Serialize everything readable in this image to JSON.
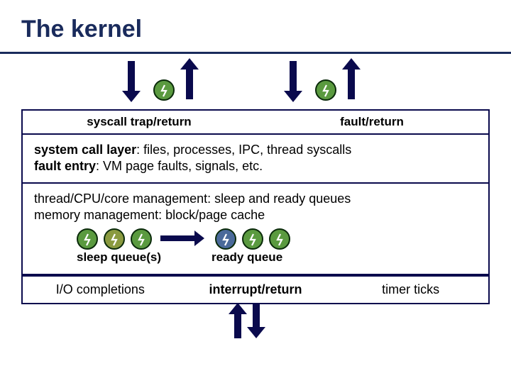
{
  "title": "The kernel",
  "header": {
    "left": "syscall trap/return",
    "right": "fault/return"
  },
  "layer1": {
    "line1_b": "system call layer",
    "line1_rest": ": files, processes, IPC, thread syscalls",
    "line2_b": "fault entry",
    "line2_rest": ": VM page faults, signals, etc."
  },
  "layer2": {
    "line1_b": "thread/CPU/core management",
    "line1_rest": ": sleep and ready queues",
    "line2_b": "memory management",
    "line2_rest": ": block/page cache"
  },
  "queues": {
    "sleep": "sleep queue(s)",
    "ready": "ready queue"
  },
  "footer": {
    "left": "I/O completions",
    "mid": "interrupt/return",
    "right": "timer ticks"
  }
}
